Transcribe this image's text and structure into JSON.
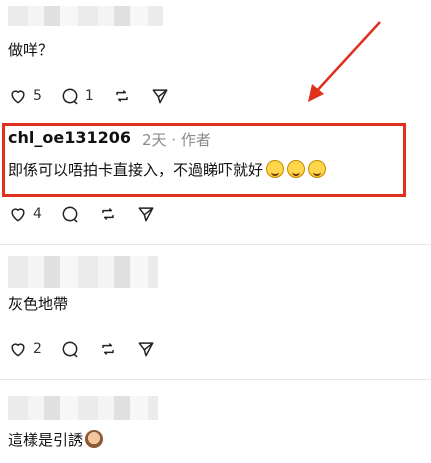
{
  "comments": [
    {
      "text": "做咩？",
      "likes": "5",
      "replies": "1"
    },
    {
      "username": "chl_oe131206",
      "time": "2天",
      "role": "作者",
      "text": "即係可以唔拍卡直接入，不過睇吓就好",
      "emoji": "rolling-on-floor-laughing x3",
      "likes": "4"
    },
    {
      "text": "灰色地帶",
      "likes": "2"
    },
    {
      "text": "這樣是引誘",
      "emoji": "see-no-evil-monkey"
    }
  ],
  "annotation": {
    "arrow_color": "#e0301e",
    "box_color": "#e0301e"
  }
}
